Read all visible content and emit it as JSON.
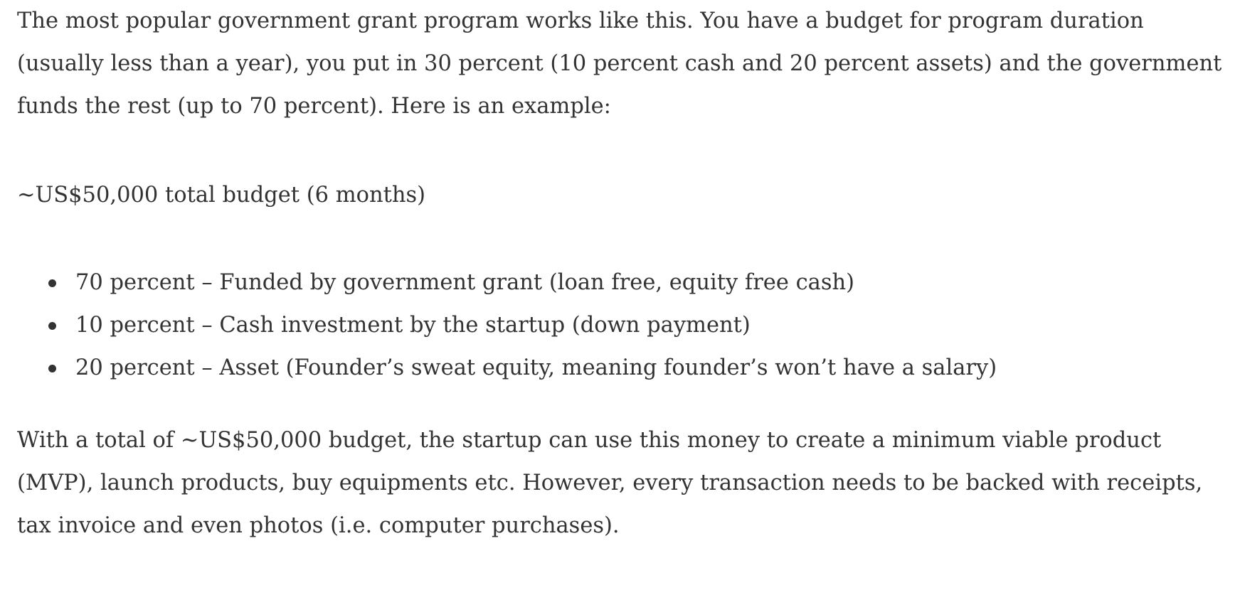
{
  "paragraphs": {
    "intro": "The most popular government grant program works like this. You have a budget for program duration (usually less than a year), you put in 30 percent (10 percent cash and 20 percent assets) and the government funds the rest (up to 70 percent). Here is an example:",
    "budget": "~US$50,000 total budget (6 months)",
    "conclusion": "With a total of ~US$50,000 budget, the startup can use this money to create a minimum viable product (MVP), launch products, buy equipments etc. However, every transaction needs to be backed with receipts, tax invoice and even photos (i.e. computer purchases)."
  },
  "bullets": [
    {
      "text": "70 percent – Funded by government grant (loan free, equity free cash)"
    },
    {
      "text": "10 percent – Cash investment by the startup (down payment)"
    },
    {
      "text": "20 percent – Asset (Founder’s sweat equity, meaning founder’s won’t have a salary)"
    }
  ]
}
